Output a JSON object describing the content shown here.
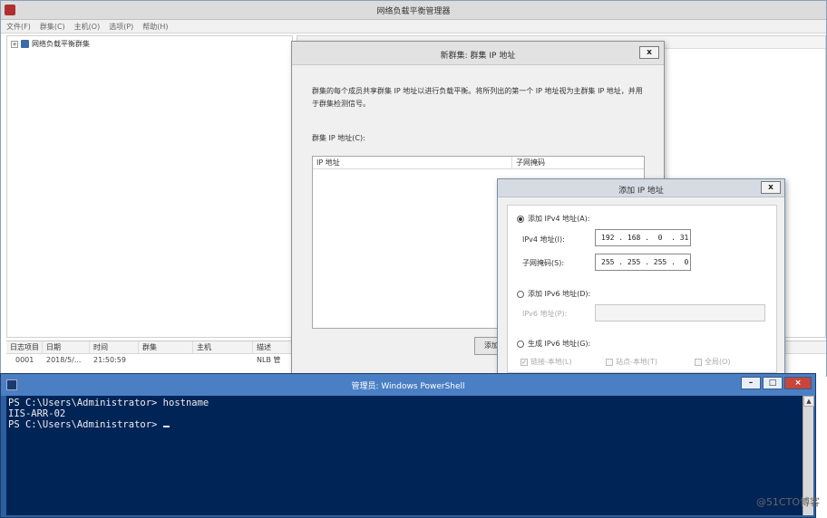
{
  "nlb": {
    "title": "网络负载平衡管理器",
    "menu": [
      "文件(F)",
      "群集(C)",
      "主机(O)",
      "选项(P)",
      "帮助(H)"
    ],
    "tree_root": "网络负载平衡群集",
    "log": {
      "columns": [
        "日志项目",
        "日期",
        "时间",
        "群集",
        "主机",
        "描述"
      ],
      "rows": [
        [
          "0001",
          "2018/5/...",
          "21:50:59",
          "",
          "",
          "NLB 管"
        ]
      ]
    }
  },
  "cluster_dialog": {
    "title": "新群集: 群集 IP 地址",
    "close": "x",
    "description": "群集的每个成员共享群集 IP 地址以进行负载平衡。将所列出的第一个 IP 地址视为主群集 IP 地址，并用于群集检测信号。",
    "list_label": "群集 IP 地址(C):",
    "columns": [
      "IP 地址",
      "子网掩码"
    ],
    "add_button": "添加"
  },
  "add_ip_dialog": {
    "title": "添加 IP 地址",
    "close": "x",
    "ipv4_option": "添加 IPv4 地址(A):",
    "ipv4_label": "IPv4 地址(I):",
    "ipv4_value": "192 . 168 .  0  . 31",
    "subnet_label": "子网掩码(S):",
    "subnet_value": "255 . 255 . 255 .  0",
    "ipv6_option": "添加 IPv6 地址(D):",
    "ipv6_label": "IPv6 地址(P):",
    "gen_ipv6_option": "生成 IPv6 地址(G):",
    "checks": [
      "链接-本地(L)",
      "站点-本地(T)",
      "全局(O)"
    ]
  },
  "powershell": {
    "title": "管理员: Windows PowerShell",
    "lines": [
      "PS C:\\Users\\Administrator> hostname",
      "IIS-ARR-02",
      "PS C:\\Users\\Administrator> "
    ],
    "colors": {
      "background": "#012456",
      "text": "#eeedf0"
    }
  },
  "watermark": "@51CTO博客"
}
